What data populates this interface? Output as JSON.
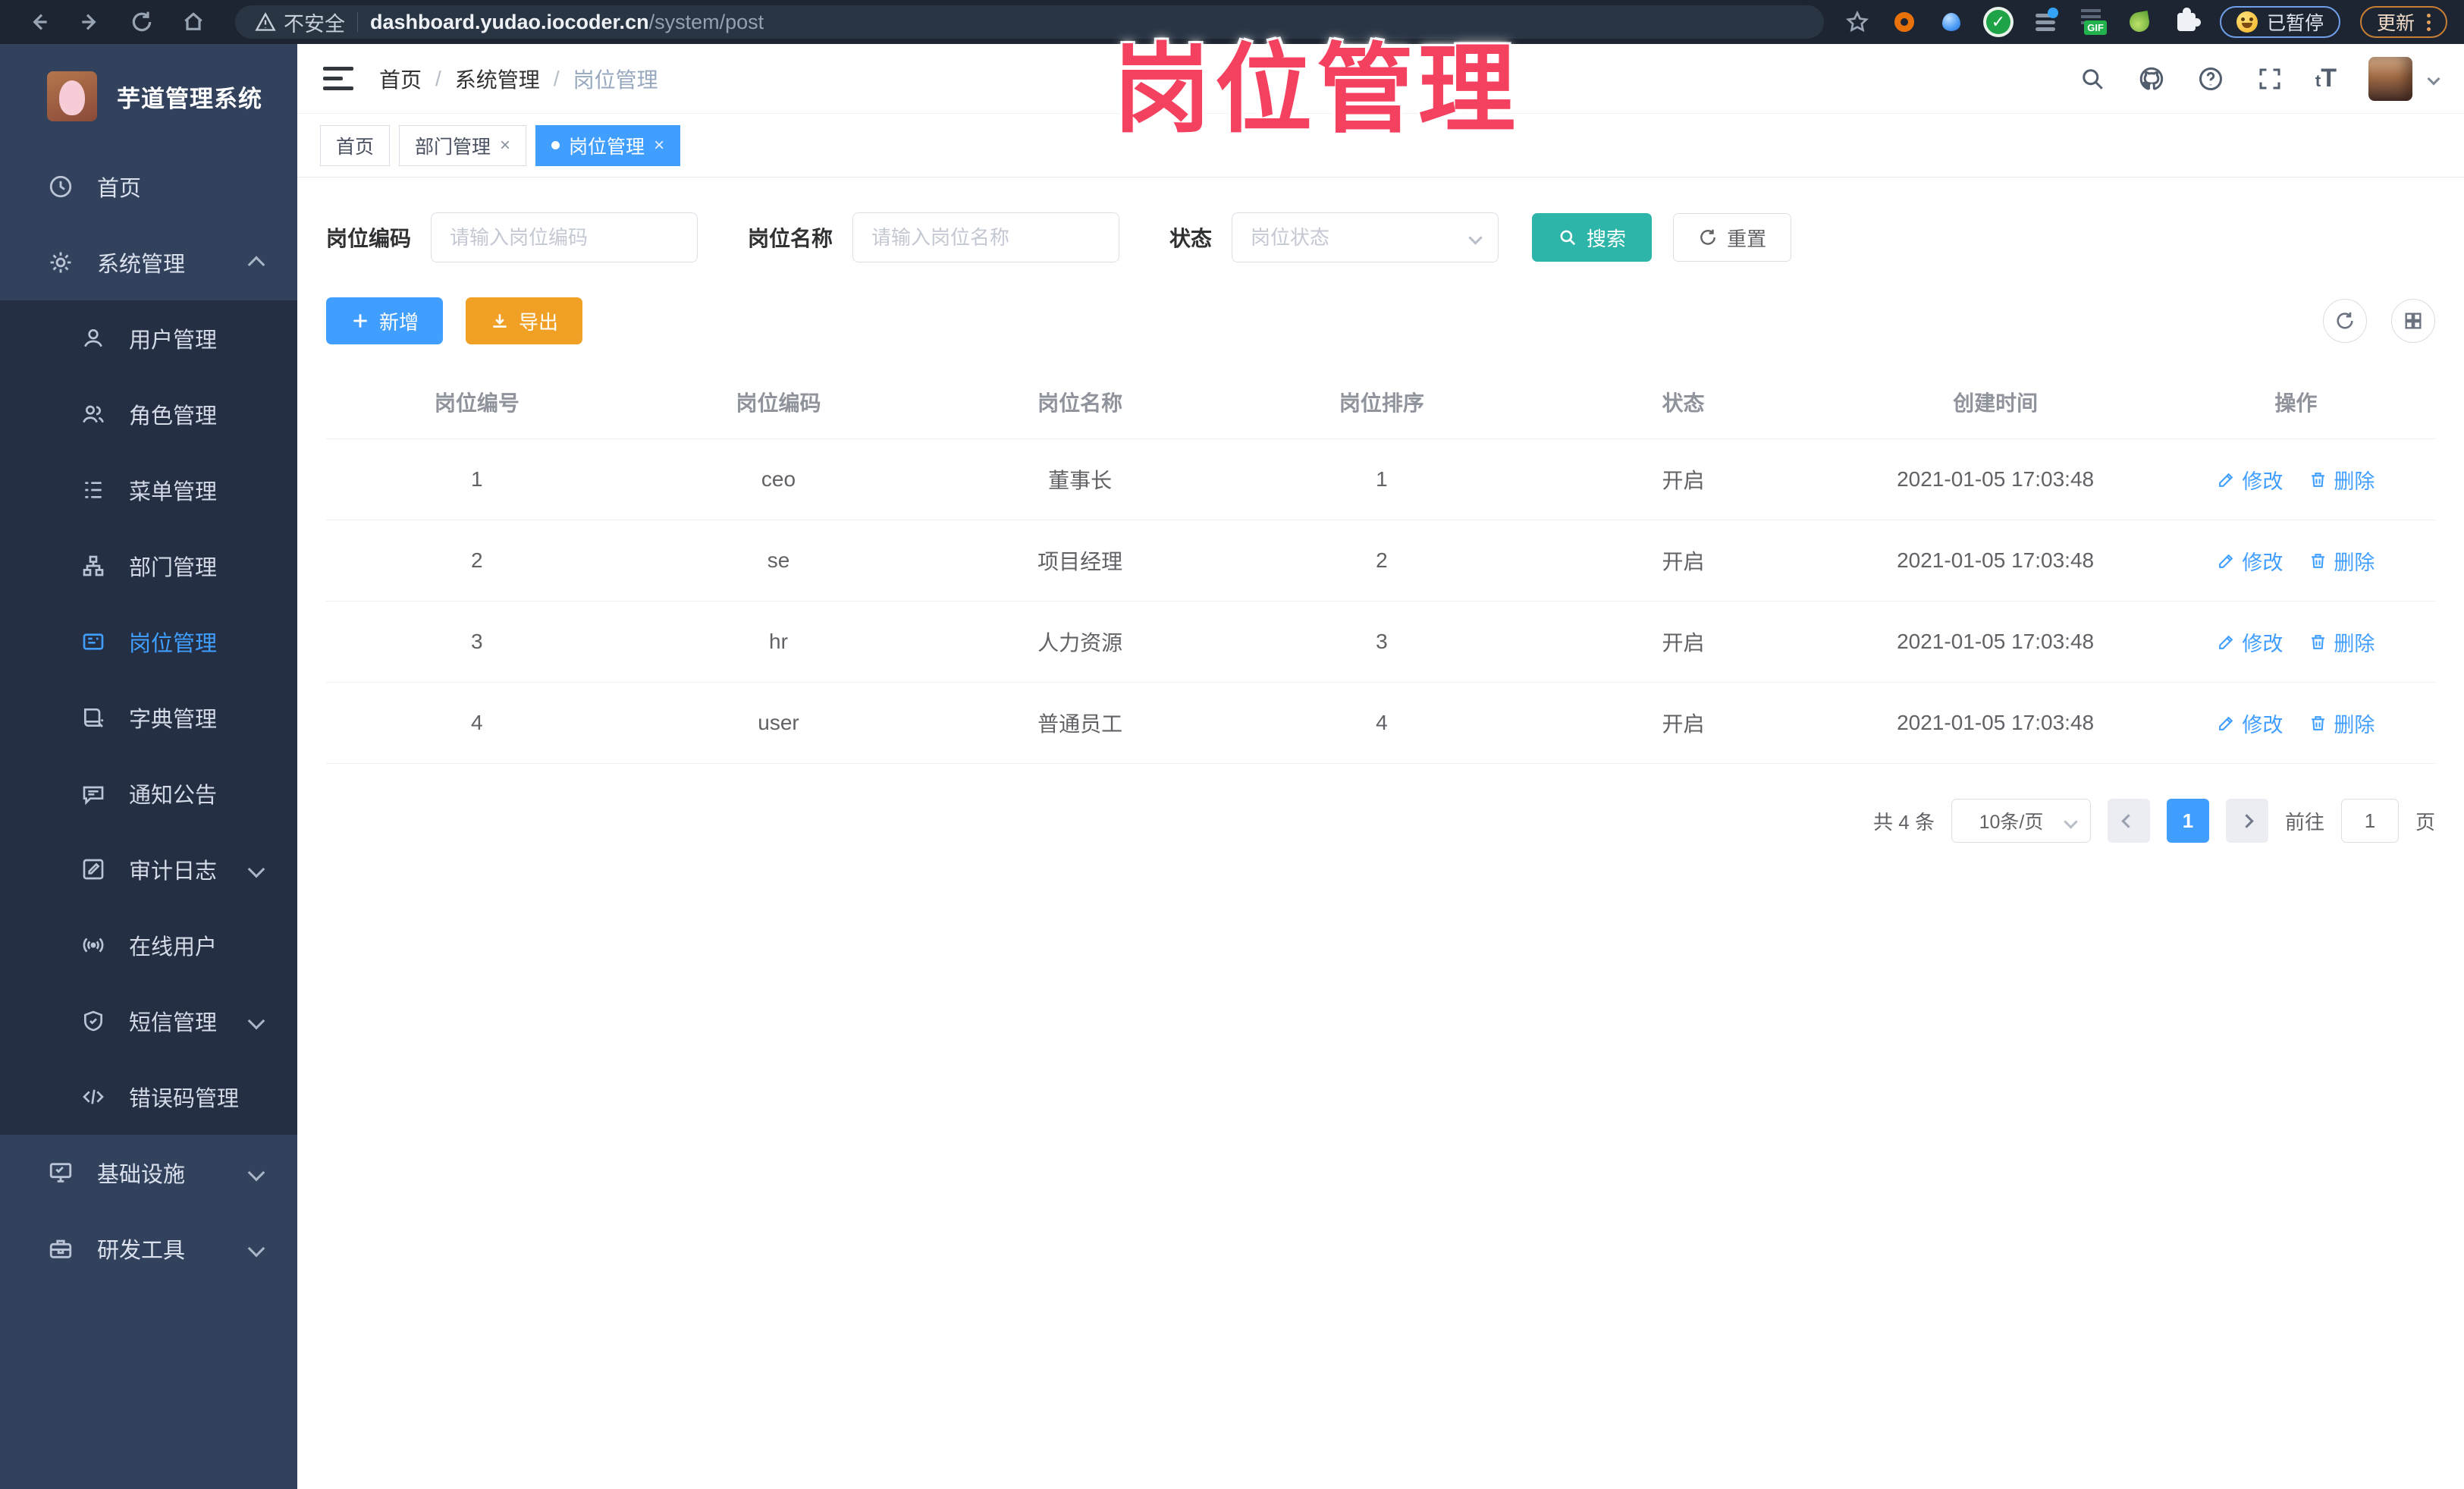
{
  "watermark": {
    "text": "岗位管理"
  },
  "browser": {
    "security_label": "不安全",
    "url_host": "dashboard.yudao.iocoder.cn",
    "url_path": "/system/post",
    "paused_label": "已暂停",
    "update_label": "更新"
  },
  "sidebar": {
    "app_title": "芋道管理系统",
    "home": "首页",
    "system": "系统管理",
    "system_children": [
      "用户管理",
      "角色管理",
      "菜单管理",
      "部门管理",
      "岗位管理",
      "字典管理",
      "通知公告",
      "审计日志",
      "在线用户",
      "短信管理",
      "错误码管理"
    ],
    "infra": "基础设施",
    "devtools": "研发工具"
  },
  "breadcrumb": {
    "separator": "/",
    "items": [
      "首页",
      "系统管理",
      "岗位管理"
    ]
  },
  "tabs": {
    "items": [
      {
        "label": "首页"
      },
      {
        "label": "部门管理"
      },
      {
        "label": "岗位管理"
      }
    ]
  },
  "filters": {
    "post_code_label": "岗位编码",
    "post_code_placeholder": "请输入岗位编码",
    "post_name_label": "岗位名称",
    "post_name_placeholder": "请输入岗位名称",
    "status_label": "状态",
    "status_placeholder": "岗位状态",
    "search_label": "搜索",
    "reset_label": "重置"
  },
  "toolbar": {
    "add_label": "新增",
    "export_label": "导出"
  },
  "table": {
    "columns": [
      "岗位编号",
      "岗位编码",
      "岗位名称",
      "岗位排序",
      "状态",
      "创建时间",
      "操作"
    ],
    "edit_label": "修改",
    "delete_label": "删除",
    "rows": [
      {
        "id": "1",
        "code": "ceo",
        "name": "董事长",
        "sort": "1",
        "status": "开启",
        "created": "2021-01-05 17:03:48"
      },
      {
        "id": "2",
        "code": "se",
        "name": "项目经理",
        "sort": "2",
        "status": "开启",
        "created": "2021-01-05 17:03:48"
      },
      {
        "id": "3",
        "code": "hr",
        "name": "人力资源",
        "sort": "3",
        "status": "开启",
        "created": "2021-01-05 17:03:48"
      },
      {
        "id": "4",
        "code": "user",
        "name": "普通员工",
        "sort": "4",
        "status": "开启",
        "created": "2021-01-05 17:03:48"
      }
    ]
  },
  "pagination": {
    "total_text": "共 4 条",
    "page_size": "10条/页",
    "current_page": "1",
    "goto_label": "前往",
    "goto_value": "1",
    "page_suffix": "页"
  }
}
